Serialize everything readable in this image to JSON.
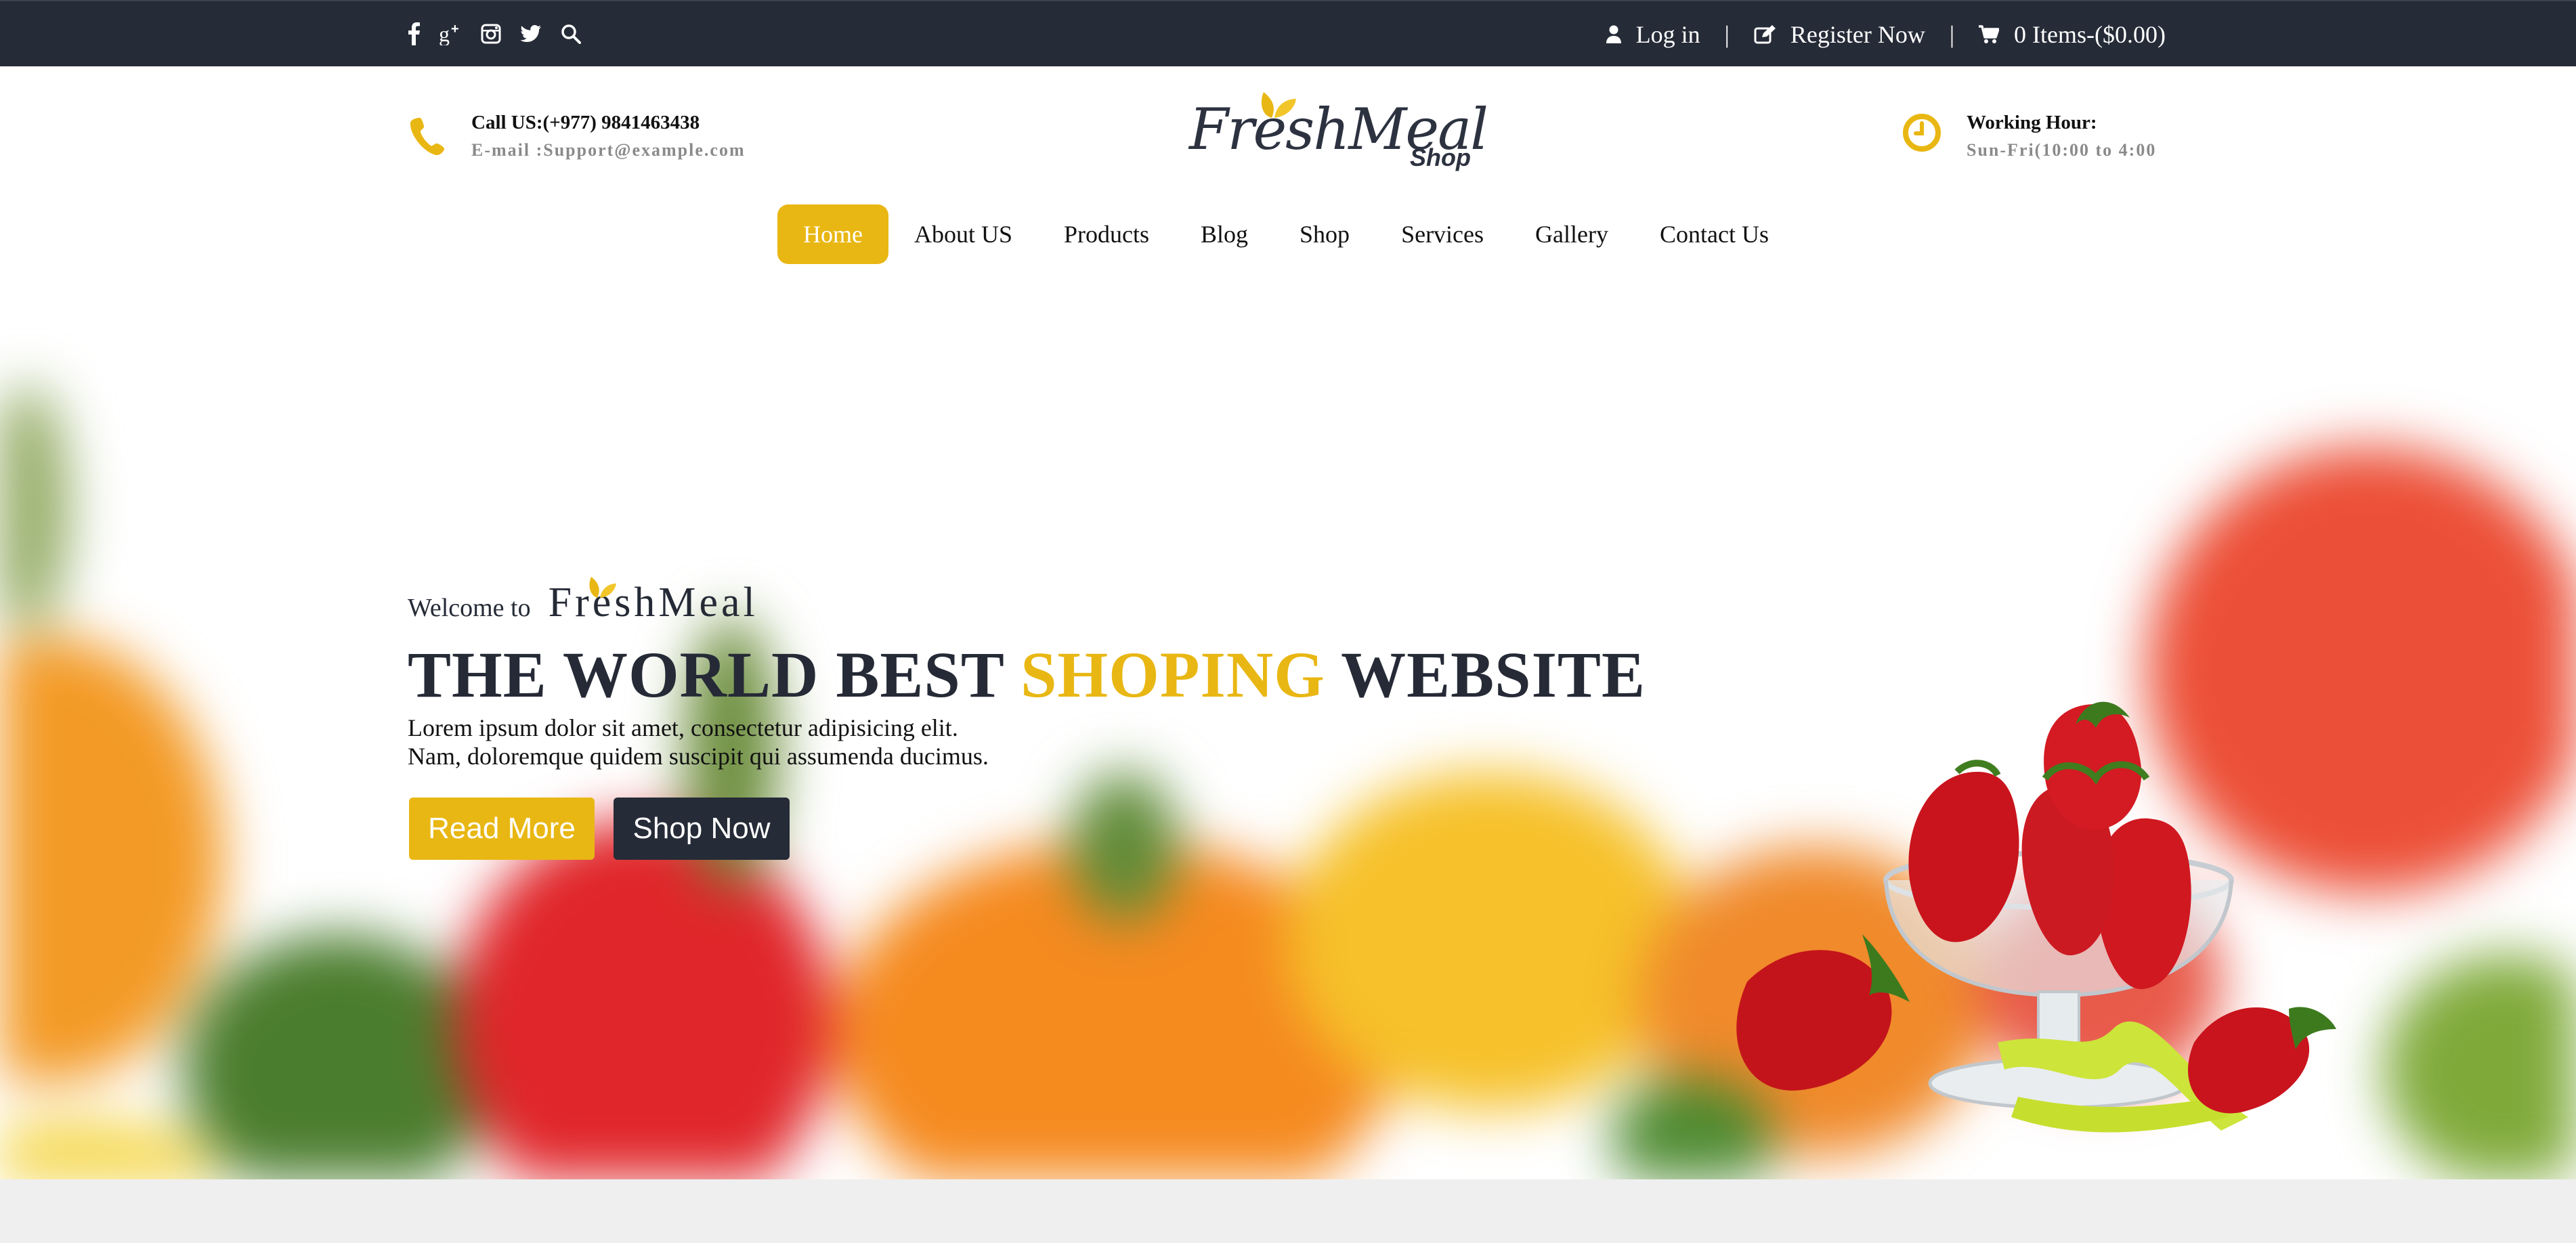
{
  "top_bar": {
    "social_icons": [
      "facebook-icon",
      "google-plus-icon",
      "instagram-icon",
      "twitter-icon",
      "search-icon"
    ],
    "login_label": "Log in",
    "register_label": "Register Now",
    "cart_label": "0 Items-($0.00)",
    "separator": "|"
  },
  "header": {
    "contact": {
      "phone_line": "Call US:(+977) 9841463438",
      "email_line": "E-mail :Support@example.com"
    },
    "logo": {
      "main": "FreshMeal",
      "sub": "Shop"
    },
    "hours": {
      "title": "Working Hour:",
      "value": "Sun-Fri(10:00 to 4:00"
    }
  },
  "nav": {
    "items": [
      {
        "label": "Home",
        "active": true
      },
      {
        "label": "About US"
      },
      {
        "label": "Products"
      },
      {
        "label": "Blog"
      },
      {
        "label": "Shop"
      },
      {
        "label": "Services"
      },
      {
        "label": "Gallery"
      },
      {
        "label": "Contact Us"
      }
    ]
  },
  "hero": {
    "welcome": "Welcome to",
    "brand": "FreshMeal",
    "title_part1": "THE WORLD BEST",
    "title_accent": "SHOPING",
    "title_part2": "WEBSITE",
    "desc_line1": "Lorem ipsum dolor sit amet, consectetur adipisicing elit.",
    "desc_line2": "Nam, doloremque quidem suscipit qui assumenda ducimus.",
    "read_more": "Read More",
    "shop_now": "Shop Now"
  },
  "colors": {
    "accent": "#e9b713",
    "dark": "#252b37"
  }
}
